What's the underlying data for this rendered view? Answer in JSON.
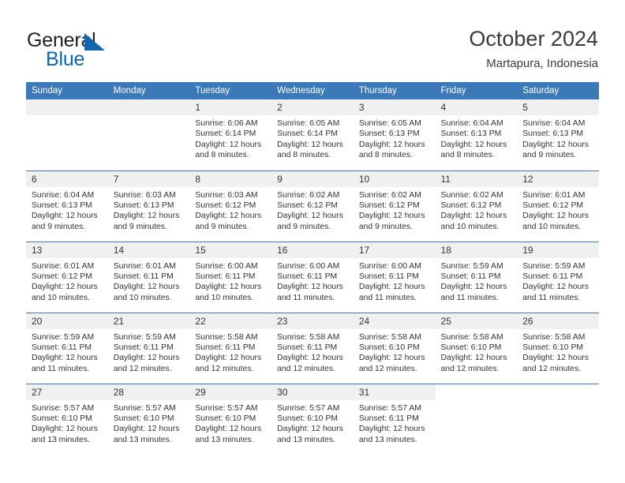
{
  "logo": {
    "word1": "General",
    "word2": "Blue",
    "triangle_color": "#1266ad",
    "blue_color": "#0a68b0"
  },
  "header": {
    "title": "October 2024",
    "subtitle": "Martapura, Indonesia",
    "accent_color": "#3b79b8",
    "daynum_band_color": "#f0f0f0"
  },
  "weekday_headers": [
    "Sunday",
    "Monday",
    "Tuesday",
    "Wednesday",
    "Thursday",
    "Friday",
    "Saturday"
  ],
  "labels": {
    "sunrise": "Sunrise:",
    "sunset": "Sunset:",
    "daylight": "Daylight:"
  },
  "weeks": [
    [
      {
        "day": "",
        "empty": true
      },
      {
        "day": "",
        "empty": true
      },
      {
        "day": "1",
        "sunrise": "Sunrise: 6:06 AM",
        "sunset": "Sunset: 6:14 PM",
        "daylight": "Daylight: 12 hours and 8 minutes."
      },
      {
        "day": "2",
        "sunrise": "Sunrise: 6:05 AM",
        "sunset": "Sunset: 6:14 PM",
        "daylight": "Daylight: 12 hours and 8 minutes."
      },
      {
        "day": "3",
        "sunrise": "Sunrise: 6:05 AM",
        "sunset": "Sunset: 6:13 PM",
        "daylight": "Daylight: 12 hours and 8 minutes."
      },
      {
        "day": "4",
        "sunrise": "Sunrise: 6:04 AM",
        "sunset": "Sunset: 6:13 PM",
        "daylight": "Daylight: 12 hours and 8 minutes."
      },
      {
        "day": "5",
        "sunrise": "Sunrise: 6:04 AM",
        "sunset": "Sunset: 6:13 PM",
        "daylight": "Daylight: 12 hours and 9 minutes."
      }
    ],
    [
      {
        "day": "6",
        "sunrise": "Sunrise: 6:04 AM",
        "sunset": "Sunset: 6:13 PM",
        "daylight": "Daylight: 12 hours and 9 minutes."
      },
      {
        "day": "7",
        "sunrise": "Sunrise: 6:03 AM",
        "sunset": "Sunset: 6:13 PM",
        "daylight": "Daylight: 12 hours and 9 minutes."
      },
      {
        "day": "8",
        "sunrise": "Sunrise: 6:03 AM",
        "sunset": "Sunset: 6:12 PM",
        "daylight": "Daylight: 12 hours and 9 minutes."
      },
      {
        "day": "9",
        "sunrise": "Sunrise: 6:02 AM",
        "sunset": "Sunset: 6:12 PM",
        "daylight": "Daylight: 12 hours and 9 minutes."
      },
      {
        "day": "10",
        "sunrise": "Sunrise: 6:02 AM",
        "sunset": "Sunset: 6:12 PM",
        "daylight": "Daylight: 12 hours and 9 minutes."
      },
      {
        "day": "11",
        "sunrise": "Sunrise: 6:02 AM",
        "sunset": "Sunset: 6:12 PM",
        "daylight": "Daylight: 12 hours and 10 minutes."
      },
      {
        "day": "12",
        "sunrise": "Sunrise: 6:01 AM",
        "sunset": "Sunset: 6:12 PM",
        "daylight": "Daylight: 12 hours and 10 minutes."
      }
    ],
    [
      {
        "day": "13",
        "sunrise": "Sunrise: 6:01 AM",
        "sunset": "Sunset: 6:12 PM",
        "daylight": "Daylight: 12 hours and 10 minutes."
      },
      {
        "day": "14",
        "sunrise": "Sunrise: 6:01 AM",
        "sunset": "Sunset: 6:11 PM",
        "daylight": "Daylight: 12 hours and 10 minutes."
      },
      {
        "day": "15",
        "sunrise": "Sunrise: 6:00 AM",
        "sunset": "Sunset: 6:11 PM",
        "daylight": "Daylight: 12 hours and 10 minutes."
      },
      {
        "day": "16",
        "sunrise": "Sunrise: 6:00 AM",
        "sunset": "Sunset: 6:11 PM",
        "daylight": "Daylight: 12 hours and 11 minutes."
      },
      {
        "day": "17",
        "sunrise": "Sunrise: 6:00 AM",
        "sunset": "Sunset: 6:11 PM",
        "daylight": "Daylight: 12 hours and 11 minutes."
      },
      {
        "day": "18",
        "sunrise": "Sunrise: 5:59 AM",
        "sunset": "Sunset: 6:11 PM",
        "daylight": "Daylight: 12 hours and 11 minutes."
      },
      {
        "day": "19",
        "sunrise": "Sunrise: 5:59 AM",
        "sunset": "Sunset: 6:11 PM",
        "daylight": "Daylight: 12 hours and 11 minutes."
      }
    ],
    [
      {
        "day": "20",
        "sunrise": "Sunrise: 5:59 AM",
        "sunset": "Sunset: 6:11 PM",
        "daylight": "Daylight: 12 hours and 11 minutes."
      },
      {
        "day": "21",
        "sunrise": "Sunrise: 5:59 AM",
        "sunset": "Sunset: 6:11 PM",
        "daylight": "Daylight: 12 hours and 12 minutes."
      },
      {
        "day": "22",
        "sunrise": "Sunrise: 5:58 AM",
        "sunset": "Sunset: 6:11 PM",
        "daylight": "Daylight: 12 hours and 12 minutes."
      },
      {
        "day": "23",
        "sunrise": "Sunrise: 5:58 AM",
        "sunset": "Sunset: 6:11 PM",
        "daylight": "Daylight: 12 hours and 12 minutes."
      },
      {
        "day": "24",
        "sunrise": "Sunrise: 5:58 AM",
        "sunset": "Sunset: 6:10 PM",
        "daylight": "Daylight: 12 hours and 12 minutes."
      },
      {
        "day": "25",
        "sunrise": "Sunrise: 5:58 AM",
        "sunset": "Sunset: 6:10 PM",
        "daylight": "Daylight: 12 hours and 12 minutes."
      },
      {
        "day": "26",
        "sunrise": "Sunrise: 5:58 AM",
        "sunset": "Sunset: 6:10 PM",
        "daylight": "Daylight: 12 hours and 12 minutes."
      }
    ],
    [
      {
        "day": "27",
        "sunrise": "Sunrise: 5:57 AM",
        "sunset": "Sunset: 6:10 PM",
        "daylight": "Daylight: 12 hours and 13 minutes."
      },
      {
        "day": "28",
        "sunrise": "Sunrise: 5:57 AM",
        "sunset": "Sunset: 6:10 PM",
        "daylight": "Daylight: 12 hours and 13 minutes."
      },
      {
        "day": "29",
        "sunrise": "Sunrise: 5:57 AM",
        "sunset": "Sunset: 6:10 PM",
        "daylight": "Daylight: 12 hours and 13 minutes."
      },
      {
        "day": "30",
        "sunrise": "Sunrise: 5:57 AM",
        "sunset": "Sunset: 6:10 PM",
        "daylight": "Daylight: 12 hours and 13 minutes."
      },
      {
        "day": "31",
        "sunrise": "Sunrise: 5:57 AM",
        "sunset": "Sunset: 6:11 PM",
        "daylight": "Daylight: 12 hours and 13 minutes."
      },
      {
        "day": "",
        "empty": true,
        "blank": true
      },
      {
        "day": "",
        "empty": true,
        "blank": true
      }
    ]
  ]
}
